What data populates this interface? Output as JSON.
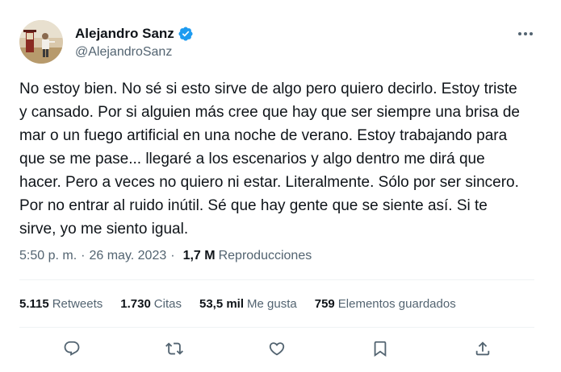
{
  "author": {
    "name": "Alejandro Sanz",
    "handle": "@AlejandroSanz",
    "verified_icon": "verified-badge-icon",
    "verified_color": "#1d9bf0"
  },
  "tweet": {
    "text": "No estoy bien. No sé si esto sirve de algo pero quiero decirlo. Estoy triste\ny cansado. Por si alguien más cree que hay que ser siempre una brisa de\nmar o un fuego artificial en una noche de verano. Estoy trabajando para\nque se me pase... llegaré a los escenarios y algo dentro me dirá que\nhacer. Pero a veces no quiero ni estar. Literalmente. Sólo por ser sincero.\nPor no entrar al ruido inútil. Sé que hay gente que se siente así. Si te\nsirve, yo me siento igual.",
    "time": "5:50 p. m.",
    "separator": "·",
    "date": "26 may. 2023",
    "views_count": "1,7 M",
    "views_label": "Reproducciones"
  },
  "stats": [
    {
      "num": "5.115",
      "label": "Retweets"
    },
    {
      "num": "1.730",
      "label": "Citas"
    },
    {
      "num": "53,5 mil",
      "label": "Me gusta"
    },
    {
      "num": "759",
      "label": "Elementos guardados"
    }
  ],
  "actions": [
    {
      "icon": "reply-icon"
    },
    {
      "icon": "retweet-icon"
    },
    {
      "icon": "like-icon"
    },
    {
      "icon": "bookmark-icon"
    },
    {
      "icon": "share-icon"
    }
  ],
  "colors": {
    "text": "#0f1419",
    "secondary": "#536471",
    "divider": "#eff3f4",
    "accent": "#1d9bf0"
  }
}
